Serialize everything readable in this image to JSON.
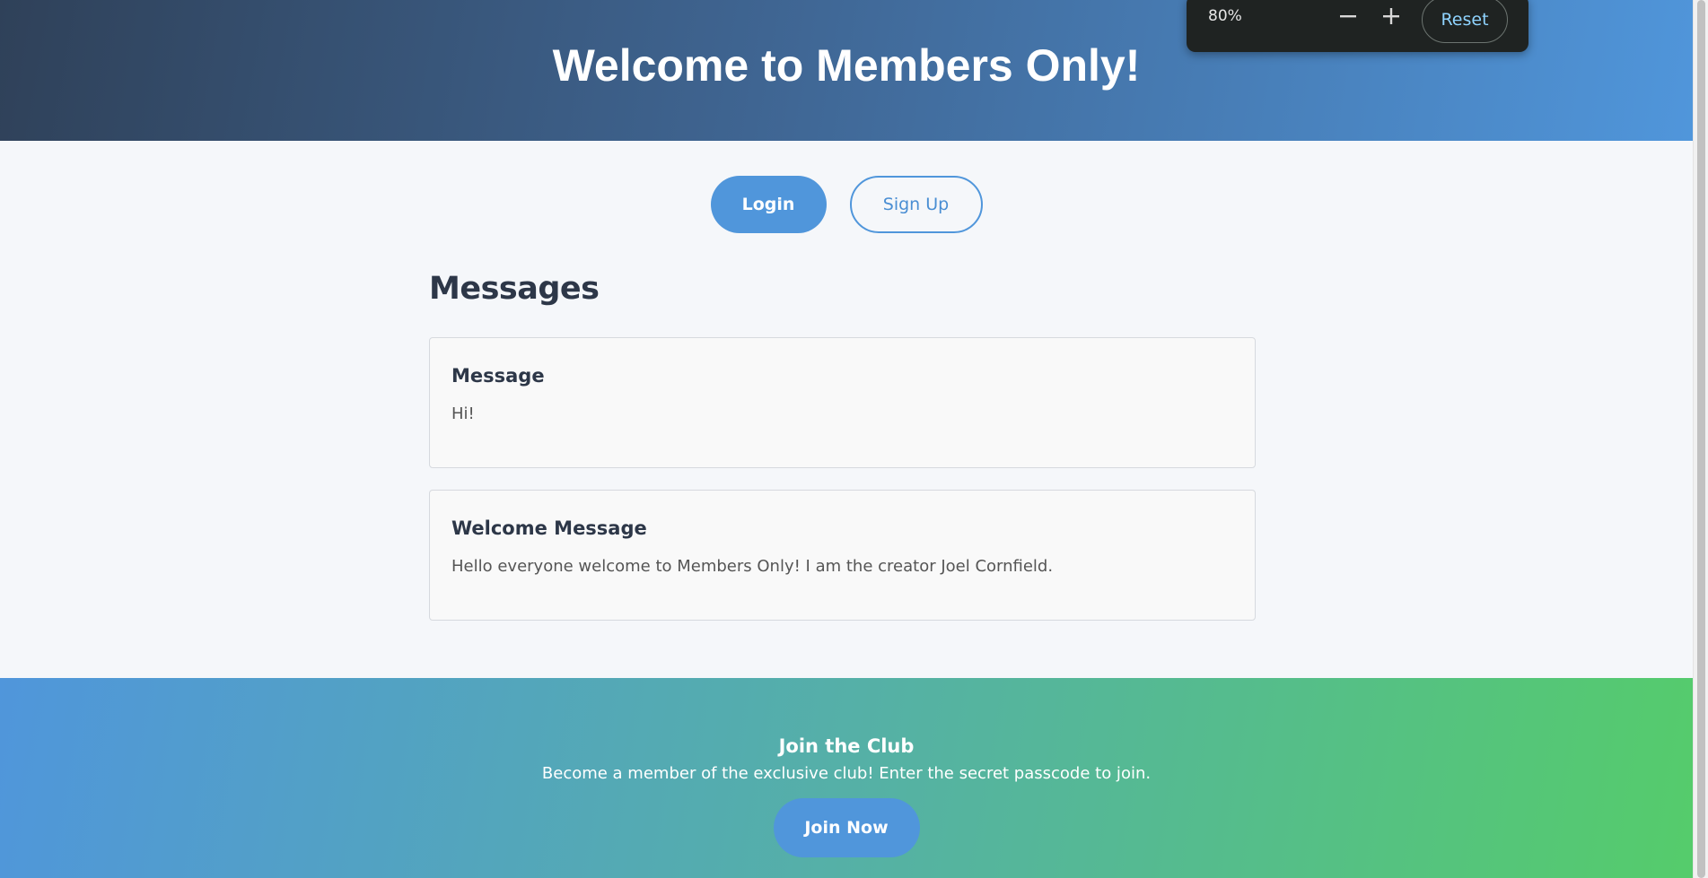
{
  "header": {
    "title": "Welcome to Members Only!"
  },
  "auth": {
    "login_label": "Login",
    "signup_label": "Sign Up"
  },
  "messages": {
    "heading": "Messages",
    "items": [
      {
        "title": "Message",
        "body": "Hi!"
      },
      {
        "title": "Welcome Message",
        "body": "Hello everyone welcome to Members Only! I am the creator Joel Cornfield."
      }
    ]
  },
  "join": {
    "title": "Join the Club",
    "text": "Become a member of the exclusive club! Enter the secret passcode to join.",
    "button_label": "Join Now"
  },
  "zoom": {
    "level": "80%",
    "minus_icon": "minus-icon",
    "plus_icon": "plus-icon",
    "reset_label": "Reset"
  },
  "colors": {
    "accent": "#5096db",
    "header_dark": "#2f4159",
    "footer_green": "#55cc6b",
    "popup_bg": "#1f2322",
    "reset_text": "#8fd3ff"
  }
}
